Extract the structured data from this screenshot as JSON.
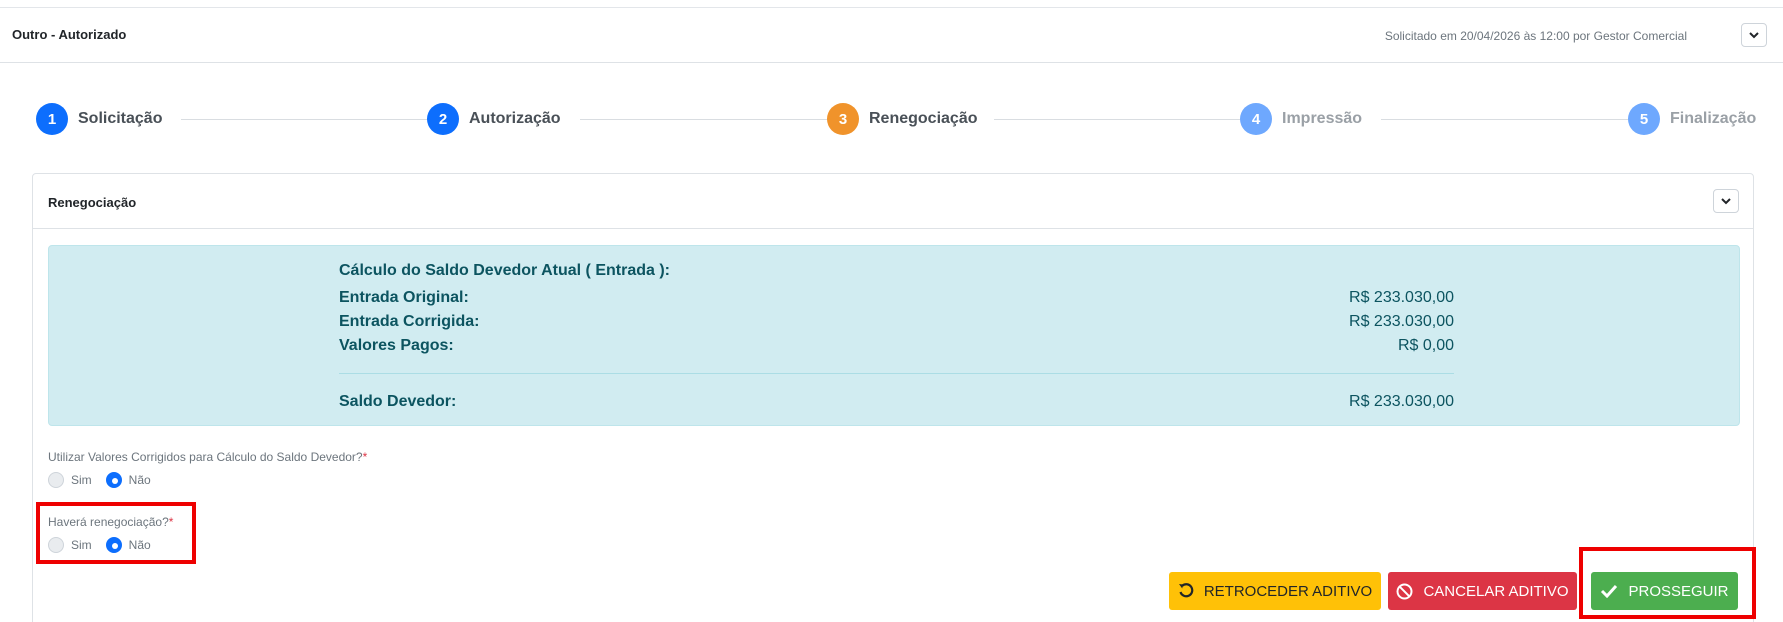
{
  "header": {
    "title": "Outro - Autorizado",
    "request_info": "Solicitado em 20/04/2026 às 12:00 por Gestor Comercial"
  },
  "steps": [
    {
      "number": "1",
      "label": "Solicitação",
      "state": "done"
    },
    {
      "number": "2",
      "label": "Autorização",
      "state": "done"
    },
    {
      "number": "3",
      "label": "Renegociação",
      "state": "current"
    },
    {
      "number": "4",
      "label": "Impressão",
      "state": "todo"
    },
    {
      "number": "5",
      "label": "Finalização",
      "state": "todo"
    }
  ],
  "card": {
    "title": "Renegociação",
    "summary": {
      "heading": "Cálculo do Saldo Devedor Atual ( Entrada ):",
      "entrada_original_label": "Entrada Original:",
      "entrada_original_value": "R$ 233.030,00",
      "entrada_corrigida_label": "Entrada Corrigida:",
      "entrada_corrigida_value": "R$ 233.030,00",
      "valores_pagos_label": "Valores Pagos:",
      "valores_pagos_value": "R$ 0,00",
      "saldo_devedor_label": "Saldo Devedor:",
      "saldo_devedor_value": "R$ 233.030,00"
    },
    "question_corrigidos": {
      "label": "Utilizar Valores Corrigidos para Cálculo do Saldo Devedor?",
      "required_mark": "*",
      "option_yes": "Sim",
      "option_no": "Não",
      "selected": "Não"
    },
    "question_renegociacao": {
      "label": "Haverá renegociação?",
      "required_mark": "*",
      "option_yes": "Sim",
      "option_no": "Não",
      "selected": "Não"
    }
  },
  "actions": {
    "retroceder": "RETROCEDER ADITIVO",
    "cancelar": "CANCELAR ADITIVO",
    "prosseguir": "PROSSEGUIR"
  },
  "colors": {
    "primary": "#0d6efd",
    "current_step": "#f0932b",
    "pending_step": "#6ea8fe",
    "info_bg": "#d1ecf1",
    "warning": "#ffc107",
    "danger": "#dc3545",
    "success": "#4cae4f",
    "highlight": "#ee0000"
  }
}
